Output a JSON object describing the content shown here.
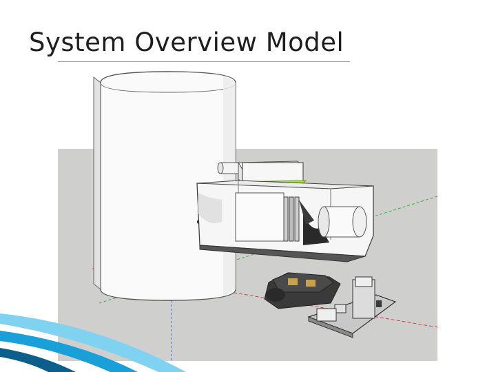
{
  "slide": {
    "title": "System Overview Model"
  },
  "model": {
    "colors": {
      "sky": "#ffffff",
      "ground": "#cfcfcd",
      "body": "#fafafa",
      "edge": "#555555",
      "accent_green": "#a8e23a",
      "dark_part": "#2e2e2e",
      "plate": "#c8c8c8",
      "gold": "#c8a24a"
    },
    "icons": [
      "cylinder-tank",
      "instrument-box",
      "mounting-plate",
      "camera-unit",
      "axis-lines"
    ]
  },
  "decoration": {
    "accent_colors": [
      "#1aa0d8",
      "#7fd2f0",
      "#0b5f8a"
    ]
  }
}
